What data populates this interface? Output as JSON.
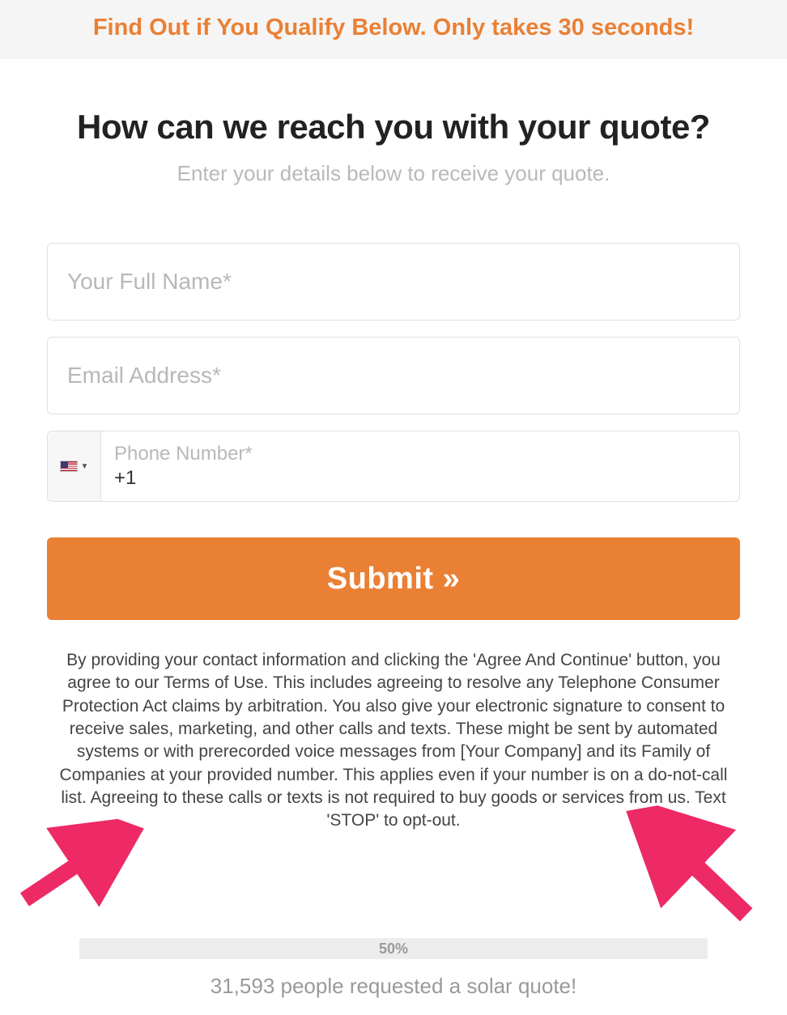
{
  "banner": {
    "text": "Find Out if You Qualify Below. Only takes 30 seconds!"
  },
  "header": {
    "title": "How can we reach you with your quote?",
    "subtitle": "Enter your details below to receive your quote."
  },
  "form": {
    "name_placeholder": "Your Full Name*",
    "email_placeholder": "Email Address*",
    "phone_label": "Phone Number*",
    "phone_value": "+1",
    "submit_label": "Submit »"
  },
  "disclosure": {
    "text": "By providing your contact information and clicking the 'Agree And Continue' button, you agree to our Terms of Use. This includes agreeing to resolve any Telephone Consumer Protection Act claims by arbitration. You also give your electronic signature to consent to receive sales, marketing, and other calls and texts. These might be sent by automated systems or with prerecorded voice messages from [Your Company] and its Family of Companies at your provided number. This applies even if your number is on a do-not-call list. Agreeing to these calls or texts is not required to buy goods or services from us. Text 'STOP' to opt-out."
  },
  "progress": {
    "label": "50%"
  },
  "social": {
    "text": "31,593 people requested a solar quote!"
  }
}
